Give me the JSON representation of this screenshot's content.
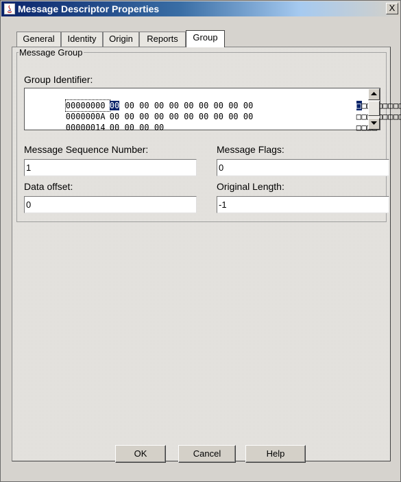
{
  "window": {
    "title": "Message Descriptor Properties",
    "close_label": "X"
  },
  "tabs": [
    {
      "label": "General"
    },
    {
      "label": "Identity"
    },
    {
      "label": "Origin"
    },
    {
      "label": "Reports"
    },
    {
      "label": "Group",
      "active": true
    }
  ],
  "group": {
    "legend": "Message Group",
    "group_identifier_label": "Group Identifier:",
    "hex_rows": [
      {
        "address": "00000000",
        "bytes": "00 00 00 00 00 00 00 00 00 00",
        "ascii": "□□□□□□□□□□"
      },
      {
        "address": "0000000A",
        "bytes": "00 00 00 00 00 00 00 00 00 00",
        "ascii": "□□□□□□□□□□"
      },
      {
        "address": "00000014",
        "bytes": "00 00 00 00",
        "ascii": "□□□□"
      }
    ],
    "selected_byte": "00",
    "fields": {
      "msg_seq_label": "Message Sequence Number:",
      "msg_seq_value": "1",
      "msg_flags_label": "Message Flags:",
      "msg_flags_value": "0",
      "data_offset_label": "Data offset:",
      "data_offset_value": "0",
      "original_length_label": "Original Length:",
      "original_length_value": "-1"
    }
  },
  "buttons": {
    "ok": "OK",
    "cancel": "Cancel",
    "help": "Help"
  },
  "colors": {
    "title_start": "#0a246a",
    "selection": "#0a246a",
    "panel_bg": "#dddbd6"
  }
}
